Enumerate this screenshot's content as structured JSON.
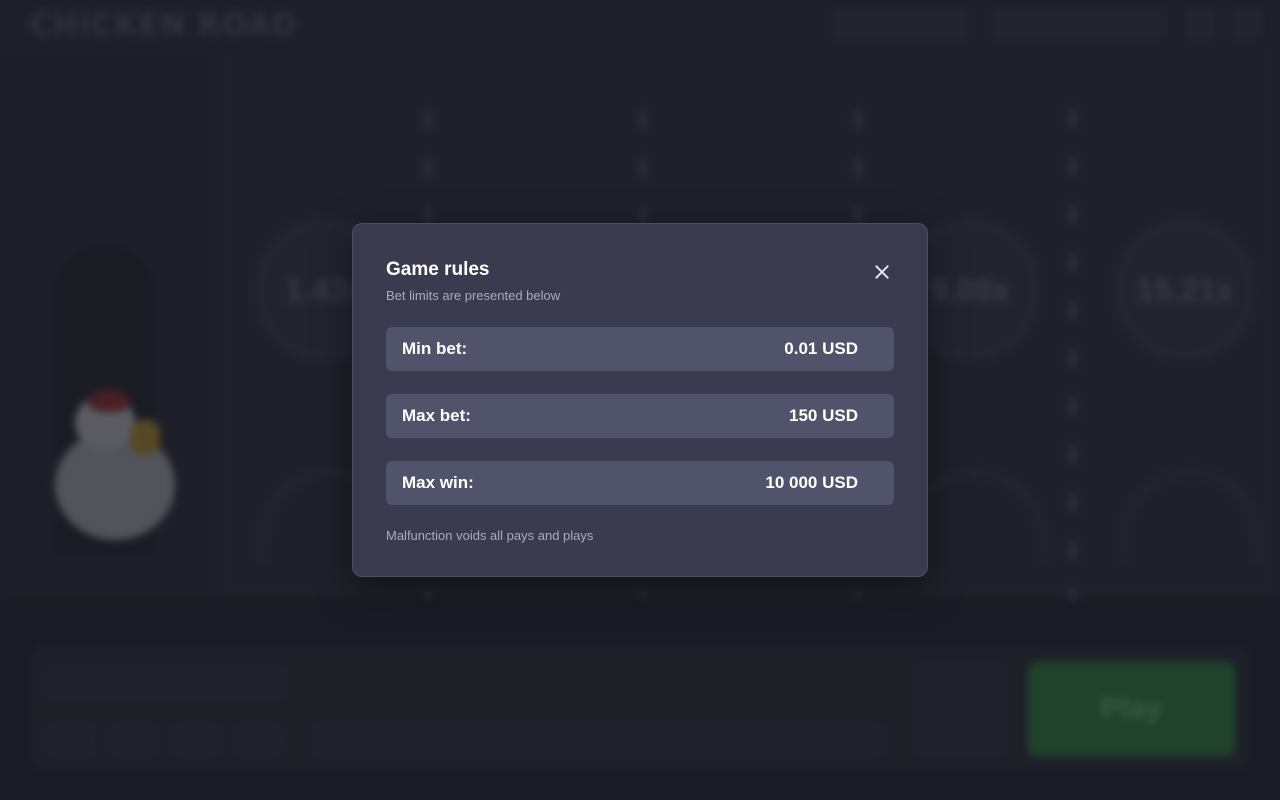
{
  "modal": {
    "title": "Game rules",
    "subtitle": "Bet limits are presented below",
    "rows": [
      {
        "label": "Min bet:",
        "value": "0.01 USD"
      },
      {
        "label": "Max bet:",
        "value": "150 USD"
      },
      {
        "label": "Max win:",
        "value": "10 000 USD"
      }
    ],
    "footer": "Malfunction voids all pays and plays"
  },
  "background": {
    "logo": "CHICKEN ROAD",
    "multipliers": [
      "1.43x",
      "9.08x",
      "15.21x"
    ],
    "play_label": "Play"
  },
  "colors": {
    "modal_bg": "#3a3b4f",
    "row_bg": "#51536a",
    "play_green": "#2e8a3c"
  }
}
